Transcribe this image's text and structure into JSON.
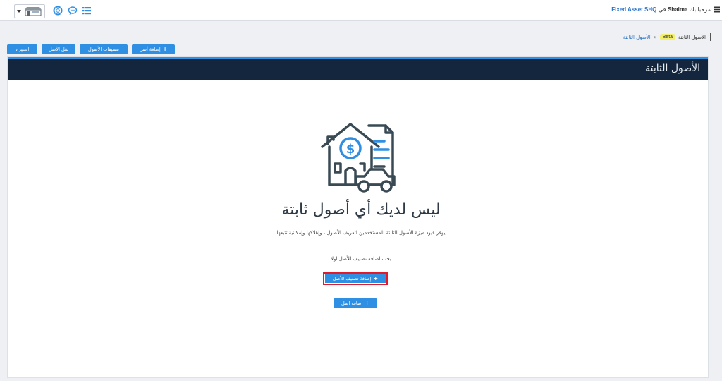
{
  "topbar": {
    "welcome_prefix": "مرحبا بك",
    "user_name": "Shaima",
    "in_word": "في",
    "company": "Fixed Asset SHQ"
  },
  "breadcrumb": {
    "current": "الأصول الثابتة",
    "badge": "Beta",
    "link": "الأصول الثابتة"
  },
  "actions": {
    "add_asset": "إضافة أصل",
    "asset_classes": "تصنيفات الأصول",
    "transfer_asset": "نقل الأصل",
    "import": "استيراد"
  },
  "panel": {
    "title": "الأصول الثابتة"
  },
  "empty_state": {
    "title": "ليس لديك أي أصول ثابتة",
    "description": "يوفر قيود ميزة الأصول الثابتة للمستخدمين لتعريف الأصول ، وإهلاكها وإمكانية تتبعها",
    "notice": "يجب اضافه تصنيف للأصل اولا",
    "add_class_button": "إضافة تصنيف للأصل",
    "add_asset_button": "اضافه اصل"
  },
  "colors": {
    "primary": "#2f8fe3",
    "header_dark": "#14263d",
    "highlight": "#e11b2a",
    "beta": "#f3ef6b"
  }
}
